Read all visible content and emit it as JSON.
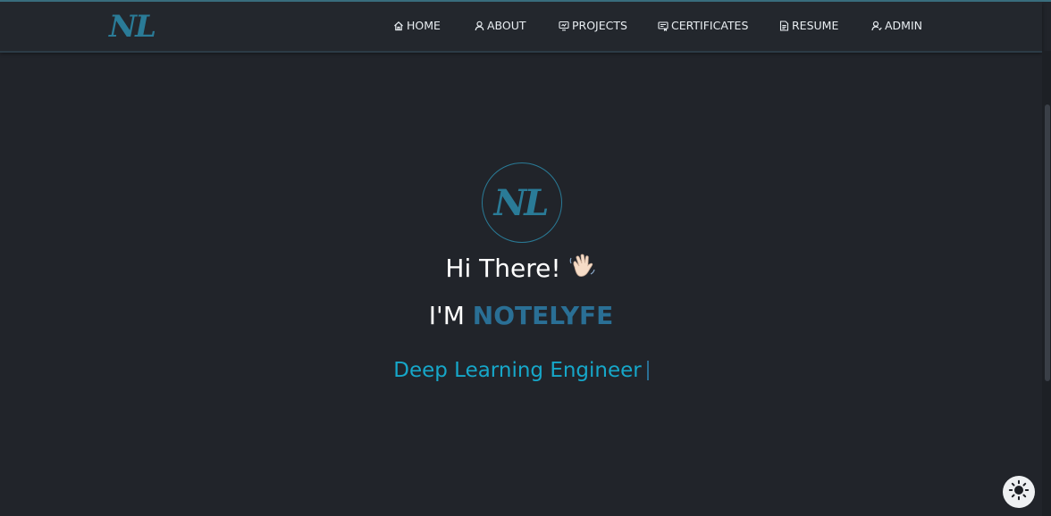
{
  "navbar": {
    "logo": "NL",
    "items": [
      {
        "label": "HOME",
        "icon": "home-icon"
      },
      {
        "label": "ABOUT",
        "icon": "user-icon"
      },
      {
        "label": "PROJECTS",
        "icon": "projects-icon"
      },
      {
        "label": "CERTIFICATES",
        "icon": "certificate-icon"
      },
      {
        "label": "RESUME",
        "icon": "document-icon"
      },
      {
        "label": "ADMIN",
        "icon": "admin-user-icon"
      }
    ]
  },
  "hero": {
    "avatar_text": "NL",
    "greeting": "Hi There!",
    "greeting_emoji": "waving-hand-icon",
    "intro_prefix": "I'M ",
    "name": "NOTELYFE",
    "role": "Deep Learning Engineer"
  },
  "theme_toggle": {
    "icon": "sun-icon"
  },
  "colors": {
    "background": "#21242a",
    "accent": "#2a7b97",
    "name": "#2a6f95",
    "role": "#16a7c9",
    "nav_text": "#e9eef2"
  }
}
